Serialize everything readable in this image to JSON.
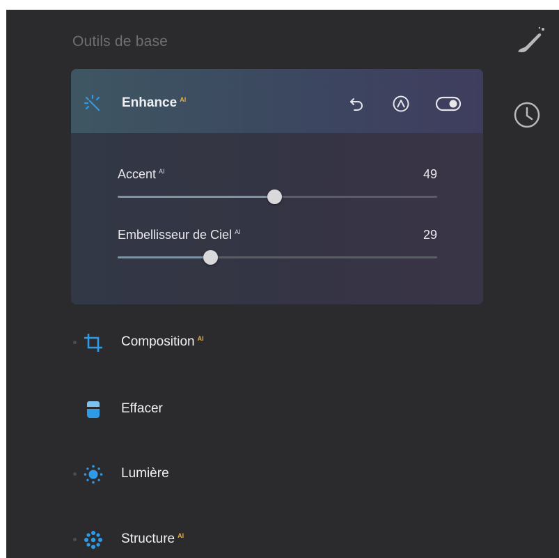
{
  "section": {
    "title": "Outils de base"
  },
  "rail": {
    "icons": [
      "brush-icon",
      "history-clock-icon"
    ]
  },
  "enhance": {
    "title": "Enhance",
    "ai_badge": "AI",
    "icon": "sparkle-icon",
    "actions": [
      "undo-icon",
      "mask-icon",
      "toggle-icon"
    ],
    "toggle_on": true,
    "sliders": [
      {
        "label": "Accent",
        "ai_badge": "AI",
        "value": "49",
        "level": 49
      },
      {
        "label": "Embellisseur de Ciel",
        "ai_badge": "AI",
        "value": "29",
        "level": 29
      }
    ]
  },
  "tools": [
    {
      "label": "Composition",
      "ai_badge": "AI",
      "icon": "crop-icon"
    },
    {
      "label": "Effacer",
      "ai_badge": "",
      "icon": "eraser-icon"
    },
    {
      "label": "Lumière",
      "ai_badge": "",
      "icon": "sun-icon"
    },
    {
      "label": "Structure",
      "ai_badge": "AI",
      "icon": "structure-icon"
    }
  ],
  "colors": {
    "panel_bg": "#2b2b2d",
    "accent_blue": "#2e9be8",
    "ai_badge": "#e9ad3c",
    "slider_fill": "#7d93a3"
  }
}
